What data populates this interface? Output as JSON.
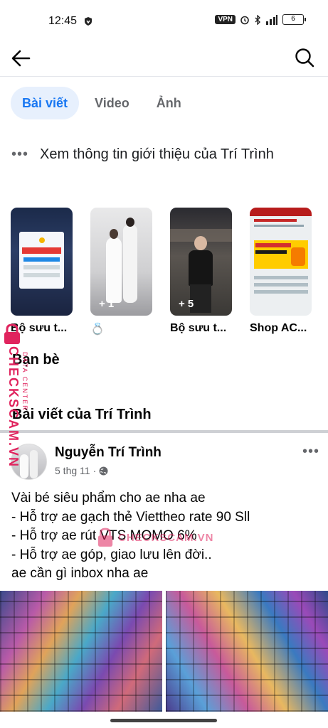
{
  "status_bar": {
    "time": "12:45",
    "vpn": "VPN",
    "battery": "6"
  },
  "header": {
    "back_icon": "arrow-left-icon",
    "search_icon": "search-icon"
  },
  "tabs": [
    {
      "label": "Bài viết",
      "active": true
    },
    {
      "label": "Video",
      "active": false
    },
    {
      "label": "Ảnh",
      "active": false
    }
  ],
  "intro": {
    "text": "Xem thông tin giới thiệu của Trí Trình"
  },
  "collections": [
    {
      "title": "Bộ sưu t...",
      "count": ""
    },
    {
      "title": "💍",
      "count": "+ 1"
    },
    {
      "title": "Bộ sưu t...",
      "count": "+ 5"
    },
    {
      "title": "Shop AC...",
      "count": ""
    }
  ],
  "sections": {
    "friends": "Bạn bè",
    "posts": "Bài viết của Trí Trình"
  },
  "post": {
    "author": "Nguyễn Trí Trình",
    "date": "5 thg 11",
    "separator": "·",
    "privacy_icon": "globe-icon",
    "lines": [
      "Vài bé siêu phẩm cho ae nha ae",
      "- Hỗ trợ ae gạch thẻ Viettheo rate 90 Sll",
      "- Hỗ trợ ae rút VTS MOMO 6%",
      "- Hỗ trợ ae góp, giao lưu lên đời..",
      "ae cần gì inbox  nha ae"
    ]
  },
  "watermark": {
    "brand": "CHECKSCAM.VN",
    "sub": "DATA CENTER"
  },
  "colors": {
    "accent": "#1877f2",
    "active_tab_bg": "#e7f0fd",
    "watermark": "#e0245e"
  }
}
